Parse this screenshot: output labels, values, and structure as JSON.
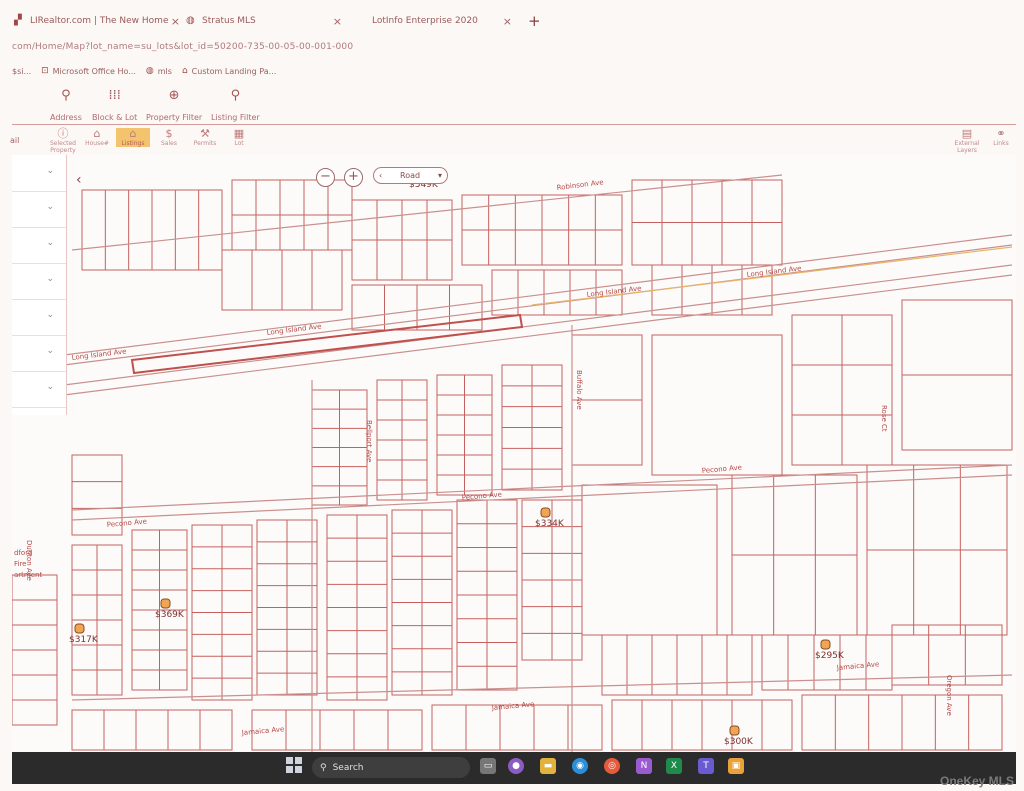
{
  "browser": {
    "tabs": [
      {
        "label": "LIRealtor.com | The New Home",
        "icon": "lirealtor-favicon"
      },
      {
        "label": "Stratus MLS",
        "icon": "globe-icon"
      },
      {
        "label": "LotInfo Enterprise 2020",
        "icon": ""
      }
    ],
    "new_tab": "+",
    "close": "×",
    "address": "com/Home/Map?lot_name=su_lots&lot_id=50200-735-00-05-00-001-000",
    "bookmarks": [
      {
        "label": "$si...",
        "icon": "bookmark-icon"
      },
      {
        "label": "Microsoft Office Ho...",
        "icon": "office-icon"
      },
      {
        "label": "mls",
        "icon": "globe-icon"
      },
      {
        "label": "Custom Landing Pa...",
        "icon": "home-icon"
      }
    ]
  },
  "search_toolbar": [
    {
      "label": "Address",
      "icon": "pin-icon"
    },
    {
      "label": "Block & Lot",
      "icon": "grid-icon"
    },
    {
      "label": "Property Filter",
      "icon": "magnifier-icon"
    },
    {
      "label": "Listing Filter",
      "icon": "pin-icon"
    }
  ],
  "layer_toolbar": {
    "left_label": "ail",
    "items": [
      {
        "label": "Selected Property",
        "icon": "info-icon"
      },
      {
        "label": "House#",
        "icon": "home-icon"
      },
      {
        "label": "Listings",
        "icon": "home-icon",
        "active": true
      },
      {
        "label": "Sales",
        "icon": "dollar-icon"
      },
      {
        "label": "Permits",
        "icon": "hammer-icon"
      },
      {
        "label": "Lot",
        "icon": "lot-icon"
      }
    ],
    "right_items": [
      {
        "label": "External Layers",
        "icon": "layers-icon"
      },
      {
        "label": "Links",
        "icon": "link-icon"
      }
    ]
  },
  "map": {
    "type_selector": "Road",
    "zoom_out": "−",
    "zoom_in": "+",
    "streets": [
      "Robinson Ave",
      "Long Island Ave",
      "Long Island Ave",
      "Long Island Ave",
      "Long Island Ave",
      "Pecono Ave",
      "Pecono Ave",
      "Pecono Ave",
      "Jamaica Ave",
      "Jamaica Ave",
      "Jamaica Ave",
      "Dunton Ave",
      "Buffalo Ave",
      "Bellport Ave",
      "Rose Ct",
      "Oregon Ave"
    ],
    "landmark": [
      "dford",
      "Fire",
      "artment"
    ],
    "listings": [
      {
        "price": "$349K"
      },
      {
        "price": "$334K"
      },
      {
        "price": "$369K"
      },
      {
        "price": "$317K"
      },
      {
        "price": "$295K"
      },
      {
        "price": "$300K"
      }
    ]
  },
  "taskbar": {
    "search_label": "Search"
  },
  "watermark": "OneKey MLS"
}
